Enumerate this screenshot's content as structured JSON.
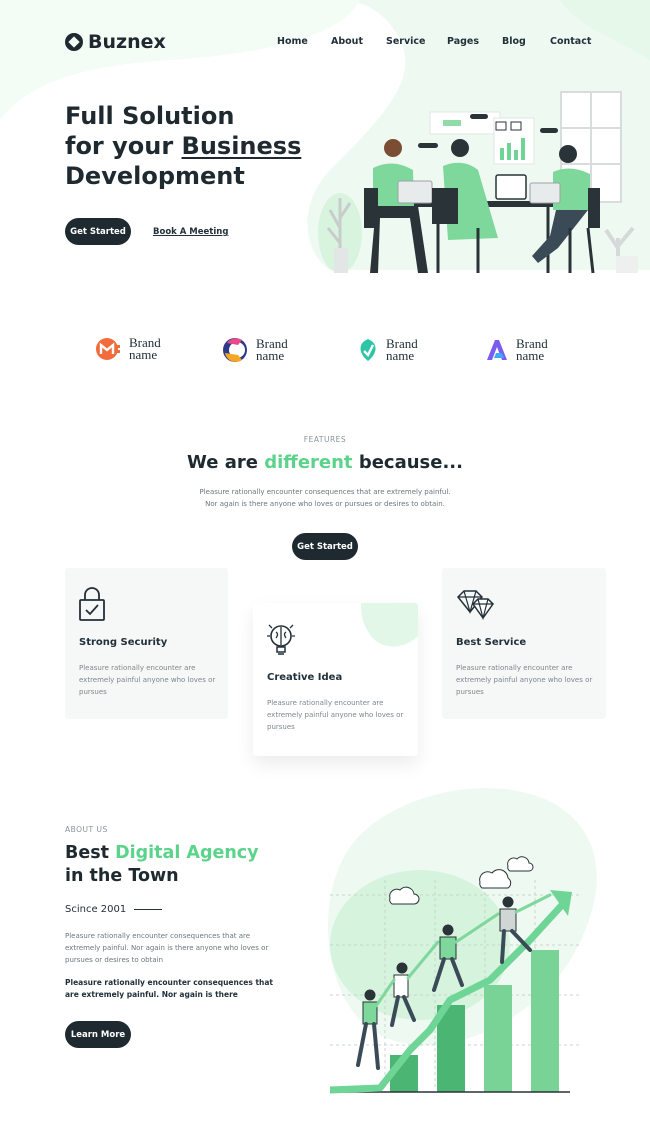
{
  "brand": {
    "name": "Buznex"
  },
  "nav": {
    "items": [
      "Home",
      "About",
      "Service",
      "Pages",
      "Blog",
      "Contact"
    ]
  },
  "hero": {
    "title_line1": "Full Solution",
    "title_line2_prefix": "for your ",
    "title_line2_highlight": "Business",
    "title_line3": "Development",
    "cta_primary": "Get Started",
    "cta_secondary": "Book A Meeting"
  },
  "partners": [
    {
      "line1": "Brand",
      "line2": "name",
      "icon": "m-logo-icon"
    },
    {
      "line1": "Brand",
      "line2": "name",
      "icon": "c-logo-icon"
    },
    {
      "line1": "Brand",
      "line2": "name",
      "icon": "leaf-logo-icon"
    },
    {
      "line1": "Brand",
      "line2": "name",
      "icon": "a-logo-icon"
    }
  ],
  "features": {
    "eyebrow": "FEATURES",
    "title_prefix": "We are ",
    "title_highlight": "different",
    "title_suffix": " because...",
    "desc_line1": "Pleasure rationally encounter consequences that are extremely painful.",
    "desc_line2": "Nor again is there anyone who loves or pursues or desires to obtain.",
    "cta": "Get Started",
    "cards": [
      {
        "title": "Strong Security",
        "text": "Pleasure rationally encounter are extremely painful anyone who loves or pursues",
        "icon": "lock-icon"
      },
      {
        "title": "Creative Idea",
        "text": "Pleasure rationally encounter are extremely painful anyone who loves or pursues",
        "icon": "brain-bulb-icon"
      },
      {
        "title": "Best Service",
        "text": "Pleasure rationally encounter are extremely painful anyone who loves or pursues",
        "icon": "diamond-icon"
      }
    ]
  },
  "about": {
    "eyebrow": "ABOUT US",
    "title_prefix": "Best ",
    "title_highlight": "Digital Agency",
    "title_line2": "in the Town",
    "since": "Scince 2001",
    "para1": "Pleasure rationally encounter consequences that are extremely painful. Nor again is there anyone who loves or pursues or desires to obtain",
    "para2": "Pleasure rationally encounter consequences that are extremely painful. Nor again is there",
    "cta": "Learn More"
  },
  "colors": {
    "accent": "#5cd38b",
    "dark": "#1f2a30",
    "mint": "#e6f8ea"
  }
}
